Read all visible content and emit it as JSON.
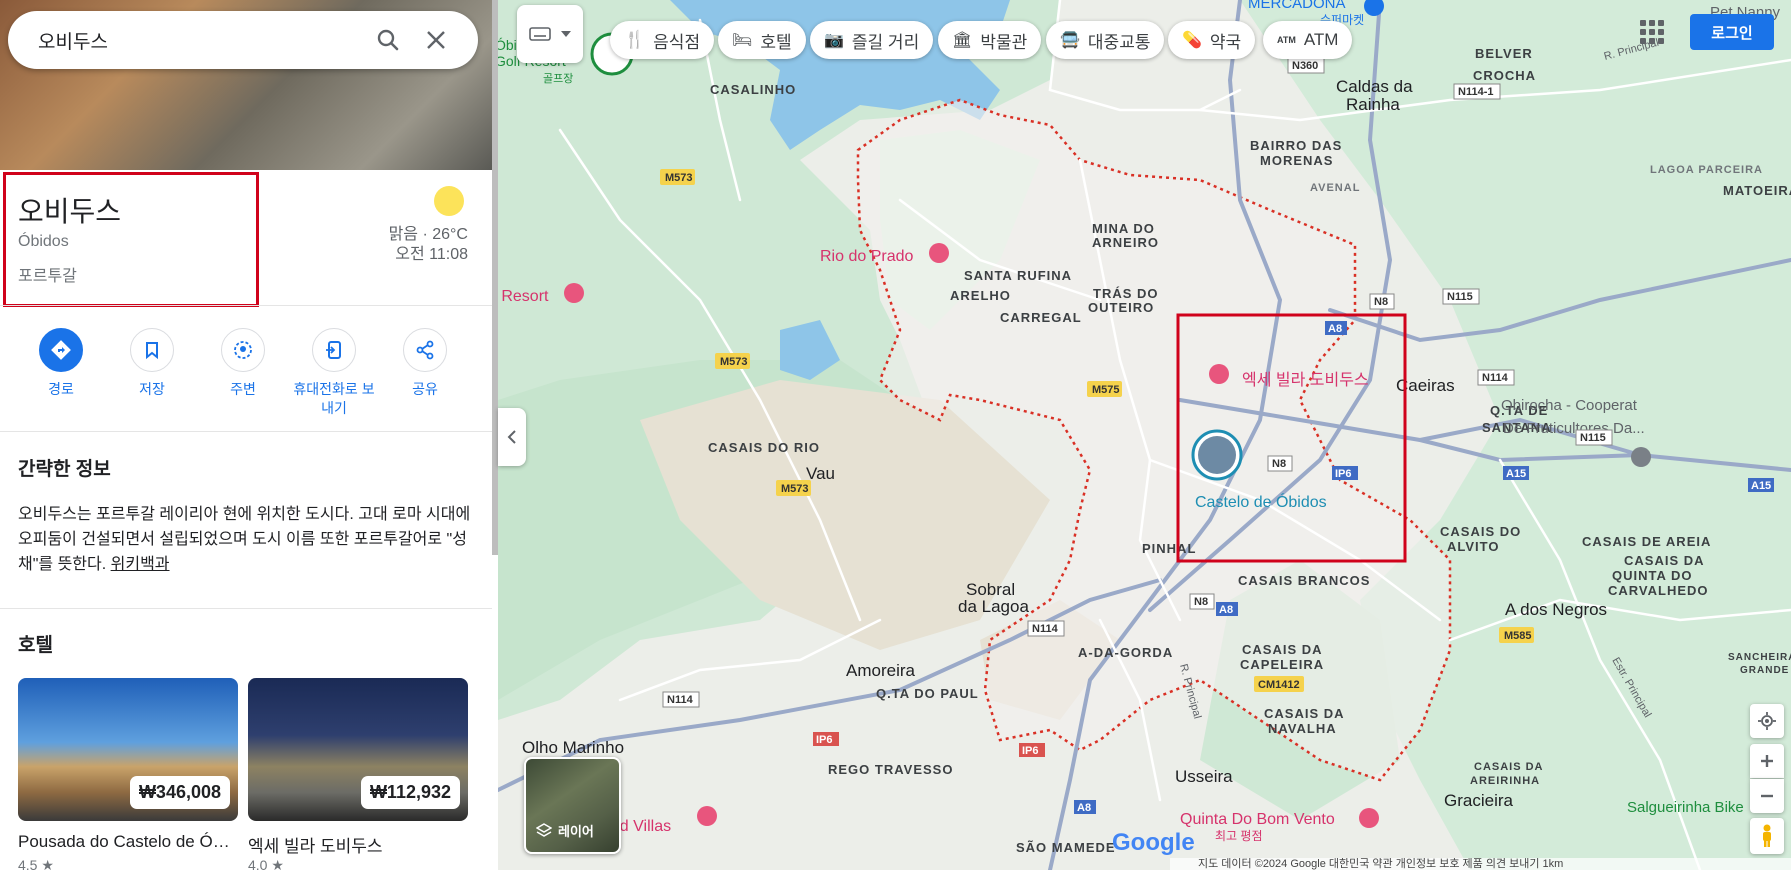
{
  "search": {
    "value": "오비두스"
  },
  "place": {
    "title": "오비두스",
    "subtitle": "Óbidos",
    "country": "포르투갈",
    "weather": "맑음 · 26°C",
    "time": "오전 11:08"
  },
  "actions": [
    {
      "label": "경로",
      "icon": "directions-icon"
    },
    {
      "label": "저장",
      "icon": "bookmark-icon"
    },
    {
      "label": "주변",
      "icon": "nearby-icon"
    },
    {
      "label": "휴대전화로 보내기",
      "icon": "send-to-phone-icon"
    },
    {
      "label": "공유",
      "icon": "share-icon"
    }
  ],
  "about": {
    "heading": "간략한 정보",
    "text": "오비두스는 포르투갈 레이리아 현에 위치한 도시다. 고대 로마 시대에 오피둠이 건설되면서 설립되었으며 도시 이름 또한 포르투갈어로 \"성채\"를 뜻한다. ",
    "link": "위키백과"
  },
  "hotels": {
    "heading": "호텔",
    "items": [
      {
        "name": "Pousada do Castelo de Óbidos",
        "price": "₩346,008",
        "rating": "4.5 ★"
      },
      {
        "name": "엑세 빌라 도비두스",
        "price": "₩112,932",
        "rating": "4.0 ★"
      }
    ]
  },
  "chips": [
    {
      "label": "음식점",
      "icon": "restaurant-icon"
    },
    {
      "label": "호텔",
      "icon": "hotel-icon"
    },
    {
      "label": "즐길 거리",
      "icon": "camera-icon"
    },
    {
      "label": "박물관",
      "icon": "museum-icon"
    },
    {
      "label": "대중교통",
      "icon": "transit-icon"
    },
    {
      "label": "약국",
      "icon": "pharmacy-icon"
    },
    {
      "label": "ATM",
      "icon": "atm-icon"
    }
  ],
  "login": "로그인",
  "layers": "레이어",
  "logo": "Google",
  "footer": "지도 데이터 ©2024 Google   대한민국   약관   개인정보 보호   제품 의견 보내기   1km",
  "map": {
    "places": [
      {
        "name": "Rio do Prado",
        "color": "#d6336c"
      },
      {
        "name": "엑세 빌라 도비두스",
        "color": "#d6336c"
      },
      {
        "name": "Castelo de Óbidos",
        "color": "#1e8eb3"
      },
      {
        "name": "Quinta Do Bom Vento",
        "color": "#d6336c"
      },
      {
        "name": "최고 평점",
        "color": "#d6336c"
      },
      {
        "name": "o Resort",
        "color": "#d6336c"
      },
      {
        "name": "ood Villas",
        "color": "#d6336c"
      },
      {
        "name": "Obirocha - Cooperat",
        "color": "#5f6368"
      },
      {
        "name": "De Fruticultores Da...",
        "color": "#5f6368"
      },
      {
        "name": "Salgueirinha Bike",
        "color": "#1e8e3e"
      },
      {
        "name": "MERCADONA",
        "color": "#1a73e8"
      },
      {
        "name": "슈퍼마켓",
        "color": "#1a73e8"
      },
      {
        "name": "Pet Nanny",
        "color": "#5f6368"
      },
      {
        "name": "Óbidos Golf Resort",
        "color": "#1e8e3e"
      },
      {
        "name": "골프장",
        "color": "#1e8e3e"
      }
    ],
    "towns_large": [
      "Caldas da Rainha",
      "Vau",
      "Sobral da Lagoa",
      "Amoreira",
      "Olho Marinho",
      "Usseira",
      "Gracieira",
      "A dos Negros",
      "Caeiras"
    ],
    "localities": [
      "CASALINHO",
      "BELVER",
      "CROCHA",
      "BAIRRO DAS MORENAS",
      "LAGOA PARCEIRA",
      "MATOEIRA",
      "MINA DO ARNEIRO",
      "SANTA RUFINA",
      "ARELHO",
      "CARREGAL",
      "TRÁS DO OUTEIRO",
      "CASAIS DO RIO",
      "Q.TA DE SANTANA",
      "CASAIS DO ALVITO",
      "CASAIS DE AREIA",
      "CASAIS DA QUINTA DO CARVALHEDO",
      "PINHAL",
      "CASAIS BRANCOS",
      "A-DA-GORDA",
      "CASAIS DA CAPELEIRA",
      "Q.TA DO PAUL",
      "CASAIS DA NAVALHA",
      "REGO TRAVESSO",
      "SÃO MAMEDE",
      "CASAIS DA AREIRINHA",
      "SANCHEIRA GRANDE",
      "AVENAL"
    ],
    "roads": [
      "M573",
      "M573",
      "M573",
      "M575",
      "N8",
      "N8",
      "N8",
      "A8",
      "A8",
      "A8",
      "N114",
      "N114",
      "N114",
      "N114-1",
      "N115",
      "N115",
      "N360",
      "IP6",
      "IP6",
      "IP6",
      "A15",
      "A15",
      "M585",
      "CM1412"
    ],
    "streets": [
      "R. Principal",
      "Estr. Principal",
      "R. Principal"
    ]
  }
}
